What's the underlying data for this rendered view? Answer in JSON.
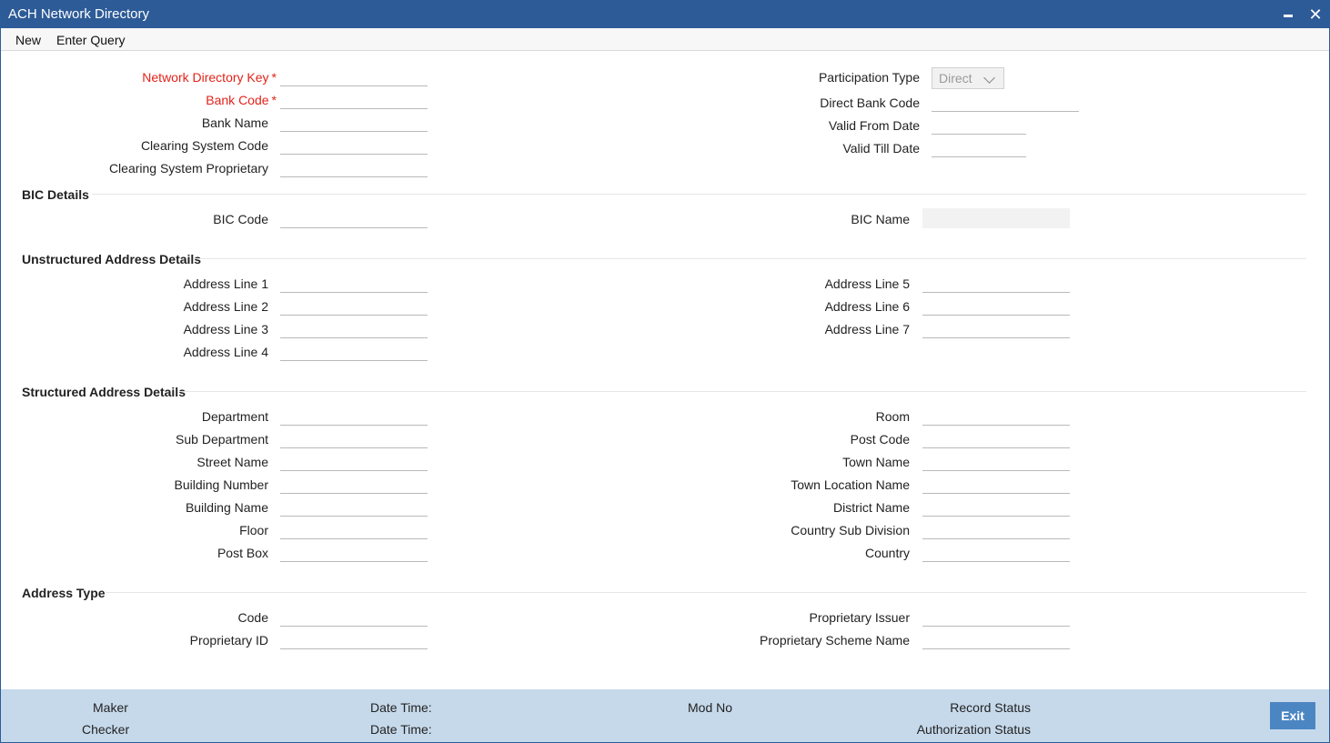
{
  "window": {
    "title": "ACH Network Directory"
  },
  "menu": {
    "items": [
      "New",
      "Enter Query"
    ]
  },
  "main": {
    "network_directory_key": "Network Directory Key",
    "bank_code": "Bank Code",
    "required_marker": "*",
    "bank_name": "Bank Name",
    "clearing_system_code": "Clearing System Code",
    "clearing_system_proprietary": "Clearing System Proprietary",
    "participation_type": "Participation Type",
    "participation_type_value": "Direct",
    "direct_bank_code": "Direct Bank Code",
    "valid_from_date": "Valid From Date",
    "valid_till_date": "Valid Till Date"
  },
  "bic": {
    "heading": "BIC Details",
    "bic_code": "BIC Code",
    "bic_name": "BIC Name"
  },
  "unstructured": {
    "heading": "Unstructured Address Details",
    "lines": [
      "Address Line 1",
      "Address Line 2",
      "Address Line 3",
      "Address Line 4",
      "Address Line 5",
      "Address Line 6",
      "Address Line 7"
    ]
  },
  "structured": {
    "heading": "Structured Address Details",
    "left": [
      "Department",
      "Sub Department",
      "Street Name",
      "Building Number",
      "Building Name",
      "Floor",
      "Post Box"
    ],
    "right": [
      "Room",
      "Post Code",
      "Town Name",
      "Town Location Name",
      "District Name",
      "Country Sub Division",
      "Country"
    ]
  },
  "address_type": {
    "heading": "Address Type",
    "code": "Code",
    "proprietary_id": "Proprietary ID",
    "proprietary_issuer": "Proprietary Issuer",
    "proprietary_scheme_name": "Proprietary Scheme Name"
  },
  "footer": {
    "maker": "Maker",
    "checker": "Checker",
    "date_time": "Date Time:",
    "mod_no": "Mod No",
    "record_status": "Record Status",
    "authorization_status": "Authorization Status",
    "exit": "Exit"
  },
  "colors": {
    "titlebar": "#2d5b97",
    "required": "#e2231a",
    "footer": "#c6d9eb",
    "exit_button": "#4c86c2"
  }
}
